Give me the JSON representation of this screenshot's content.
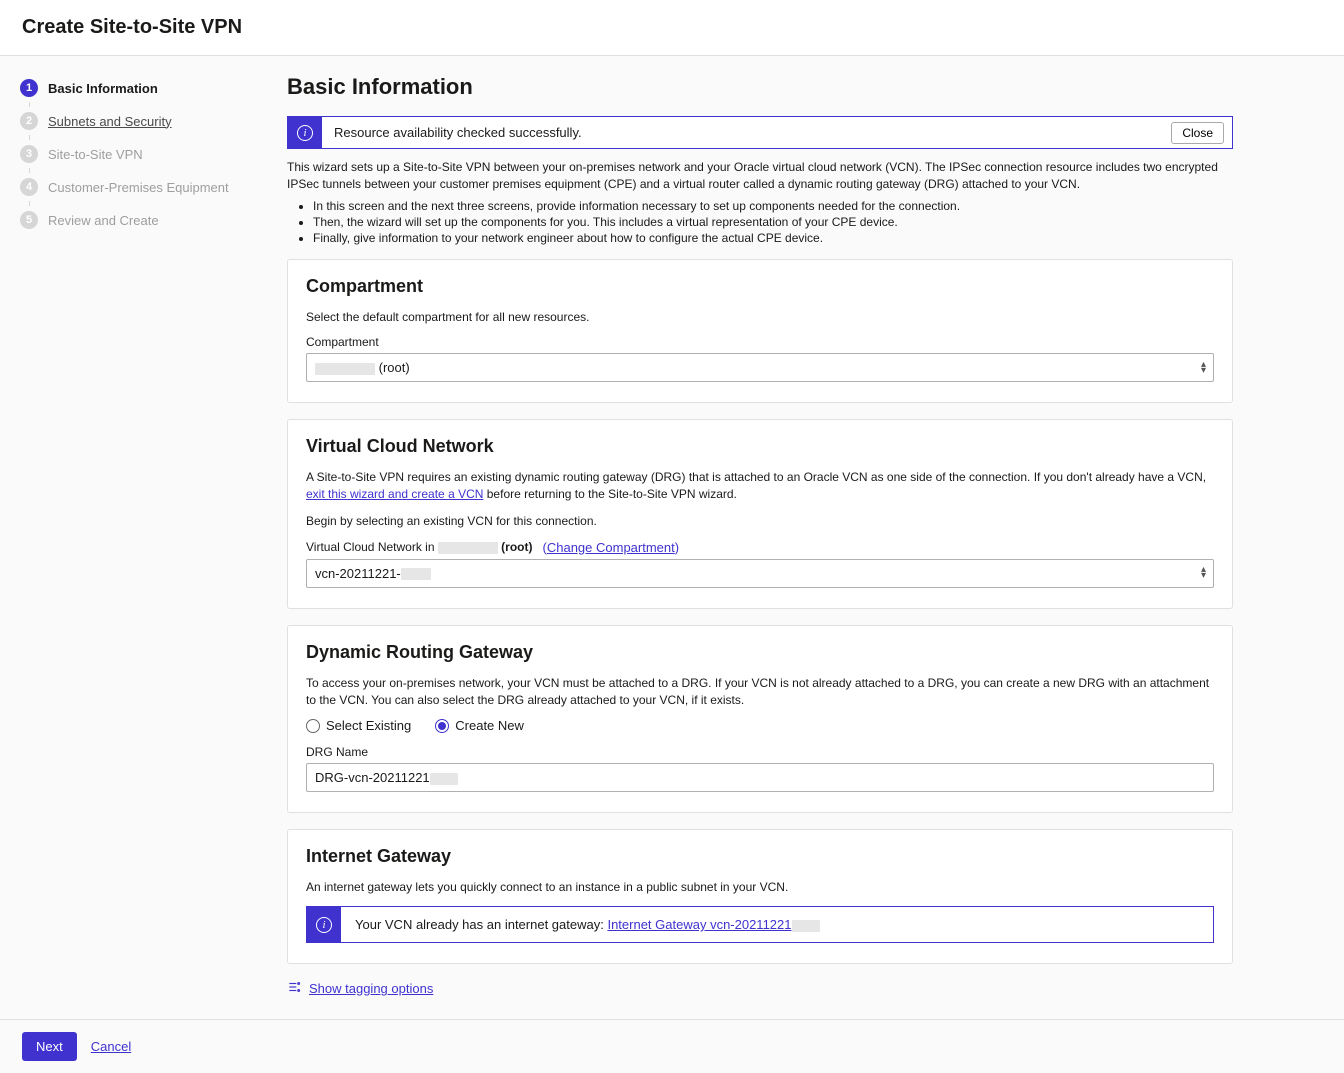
{
  "header": {
    "title": "Create Site-to-Site VPN"
  },
  "steps": [
    {
      "num": "1",
      "label": "Basic Information",
      "state": "active"
    },
    {
      "num": "2",
      "label": "Subnets and Security",
      "state": "linked"
    },
    {
      "num": "3",
      "label": "Site-to-Site VPN",
      "state": "disabled"
    },
    {
      "num": "4",
      "label": "Customer-Premises Equipment",
      "state": "disabled"
    },
    {
      "num": "5",
      "label": "Review and Create",
      "state": "disabled"
    }
  ],
  "page": {
    "heading": "Basic Information"
  },
  "alert1": {
    "text": "Resource availability checked successfully.",
    "close": "Close"
  },
  "intro": {
    "p1": "This wizard sets up a Site-to-Site VPN between your on-premises network and your Oracle virtual cloud network (VCN). The IPSec connection resource includes two encrypted IPSec tunnels between your customer premises equipment (CPE) and a virtual router called a dynamic routing gateway (DRG) attached to your VCN.",
    "bullets": [
      "In this screen and the next three screens, provide information necessary to set up components needed for the connection.",
      "Then, the wizard will set up the components for you. This includes a virtual representation of your CPE device.",
      "Finally, give information to your network engineer about how to configure the actual CPE device."
    ]
  },
  "compartment": {
    "title": "Compartment",
    "desc": "Select the default compartment for all new resources.",
    "label": "Compartment",
    "value_suffix": " (root)"
  },
  "vcn": {
    "title": "Virtual Cloud Network",
    "desc_pre": "A Site-to-Site VPN requires an existing dynamic routing gateway (DRG) that is attached to an Oracle VCN as one side of the connection. If you don't already have a VCN, ",
    "link1": "exit this wizard and create a VCN",
    "desc_post": " before returning to the Site-to-Site VPN wizard.",
    "desc2": "Begin by selecting an existing VCN for this connection.",
    "label_pre": "Virtual Cloud Network in ",
    "label_suffix": " (root)",
    "change_link": "Change Compartment",
    "value": "vcn-20211221-"
  },
  "drg": {
    "title": "Dynamic Routing Gateway",
    "desc": "To access your on-premises network, your VCN must be attached to a DRG. If your VCN is not already attached to a DRG, you can create a new DRG with an attachment to the VCN. You can also select the DRG already attached to your VCN, if it exists.",
    "opt1": "Select Existing",
    "opt2": "Create New",
    "name_label": "DRG Name",
    "name_value": "DRG-vcn-20211221"
  },
  "igw": {
    "title": "Internet Gateway",
    "desc": "An internet gateway lets you quickly connect to an instance in a public subnet in your VCN.",
    "alert_pre": "Your VCN already has an internet gateway: ",
    "alert_link": "Internet Gateway vcn-20211221"
  },
  "tagging": {
    "link": "Show tagging options"
  },
  "footer": {
    "next": "Next",
    "cancel": "Cancel"
  }
}
